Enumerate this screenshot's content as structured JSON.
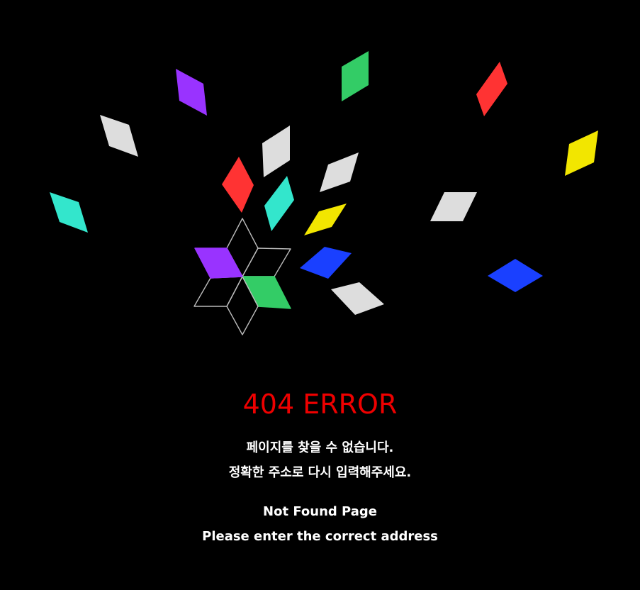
{
  "colors": {
    "background": "#000000",
    "error_title": "#ee0000",
    "text": "#ffffff",
    "outline": "#bbbbbb",
    "purple": "#9933ff",
    "green": "#33cc66",
    "red": "#ff3333",
    "white": "#dddddd",
    "yellow": "#f2e600",
    "teal": "#33e6cc",
    "blue": "#1a40ff"
  },
  "illustration": {
    "petals": [
      {
        "name": "petal-top",
        "fill": "none"
      },
      {
        "name": "petal-upper-right",
        "fill": "none"
      },
      {
        "name": "petal-lower-right",
        "fill": "green"
      },
      {
        "name": "petal-bottom",
        "fill": "none"
      },
      {
        "name": "petal-lower-left",
        "fill": "none"
      },
      {
        "name": "petal-upper-left",
        "fill": "purple"
      }
    ],
    "scattered_diamonds": [
      {
        "name": "diamond-purple",
        "color": "purple"
      },
      {
        "name": "diamond-green",
        "color": "green"
      },
      {
        "name": "diamond-red-far-right",
        "color": "red"
      },
      {
        "name": "diamond-white-left",
        "color": "white"
      },
      {
        "name": "diamond-white-center-top",
        "color": "white"
      },
      {
        "name": "diamond-yellow-right",
        "color": "yellow"
      },
      {
        "name": "diamond-red-center",
        "color": "red"
      },
      {
        "name": "diamond-white-center",
        "color": "white"
      },
      {
        "name": "diamond-teal-left",
        "color": "teal"
      },
      {
        "name": "diamond-teal-center",
        "color": "teal"
      },
      {
        "name": "diamond-yellow-center",
        "color": "yellow"
      },
      {
        "name": "diamond-white-right",
        "color": "white"
      },
      {
        "name": "diamond-blue-center",
        "color": "blue"
      },
      {
        "name": "diamond-blue-right",
        "color": "blue"
      },
      {
        "name": "diamond-white-bottom",
        "color": "white"
      }
    ]
  },
  "message": {
    "title": "404 ERROR",
    "korean_line_1": "페이지를 찾을 수 없습니다.",
    "korean_line_2": "정확한 주소로 다시 입력해주세요.",
    "english_line_1": "Not Found Page",
    "english_line_2": "Please enter the correct address"
  }
}
